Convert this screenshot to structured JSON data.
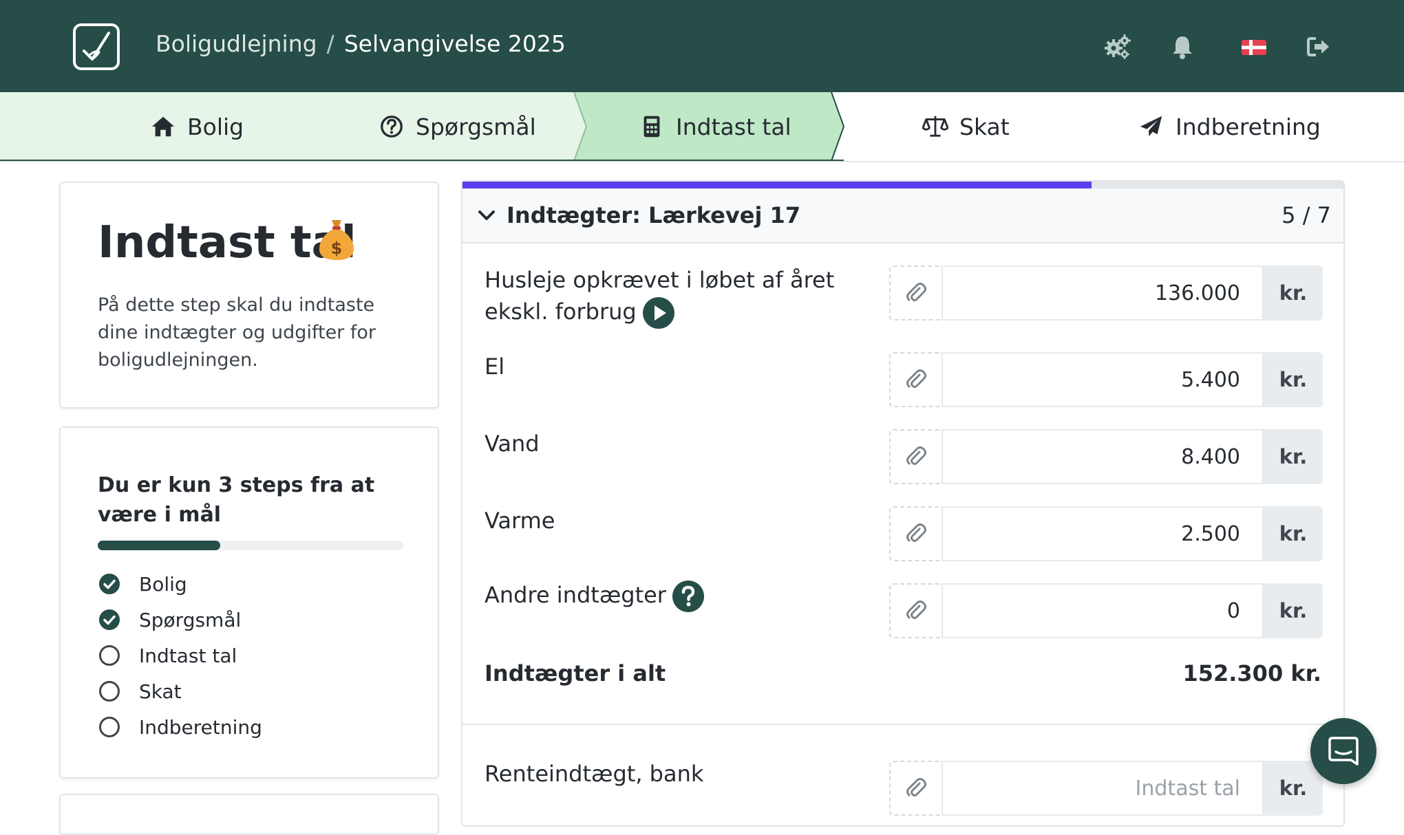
{
  "header": {
    "breadcrumb": [
      "Boligudlejning",
      "Selvangivelse 2025"
    ],
    "separator": "/",
    "icons": [
      "settings-icon",
      "bell-icon",
      "danish-flag-icon",
      "logout-icon"
    ]
  },
  "steps": [
    {
      "label": "Bolig",
      "icon": "home-icon",
      "state": "done"
    },
    {
      "label": "Spørgsmål",
      "icon": "question-circle-icon",
      "state": "done"
    },
    {
      "label": "Indtast tal",
      "icon": "calculator-icon",
      "state": "active"
    },
    {
      "label": "Skat",
      "icon": "balance-scale-icon",
      "state": "todo"
    },
    {
      "label": "Indberetning",
      "icon": "paper-plane-icon",
      "state": "todo"
    }
  ],
  "intro": {
    "title": "Indtast tal",
    "emoji": "💰",
    "text": "På dette step skal du indtaste dine indtægter og udgifter for boligudlejningen."
  },
  "progress_card": {
    "heading": "Du er kun 3 steps fra at være i mål",
    "progress": 0.4,
    "items": [
      {
        "label": "Bolig",
        "done": true
      },
      {
        "label": "Spørgsmål",
        "done": true
      },
      {
        "label": "Indtast tal",
        "done": false
      },
      {
        "label": "Skat",
        "done": false
      },
      {
        "label": "Indberetning",
        "done": false
      }
    ]
  },
  "section": {
    "title": "Indtægter: Lærkevej 17",
    "count": "5 / 7",
    "progress": 0.714,
    "rows": [
      {
        "label": "Husleje opkrævet i løbet af året ekskl. forbrug",
        "value": "136.000",
        "unit": "kr."
      },
      {
        "label": "El",
        "value": "5.400",
        "unit": "kr."
      },
      {
        "label": "Vand",
        "value": "8.400",
        "unit": "kr."
      },
      {
        "label": "Varme",
        "value": "2.500",
        "unit": "kr."
      },
      {
        "label": "Andre indtægter",
        "value": "0",
        "unit": "kr."
      }
    ],
    "total_label": "Indtægter i alt",
    "total_value": "152.300 kr.",
    "extra_row": {
      "label": "Renteindtægt, bank",
      "placeholder": "Indtast tal",
      "unit": "kr."
    }
  },
  "colors": {
    "brand": "#264d47",
    "step_done_bg": "#e6f5e8",
    "step_active_bg": "#bfe8c6",
    "progress_accent": "#5b3ef0"
  }
}
